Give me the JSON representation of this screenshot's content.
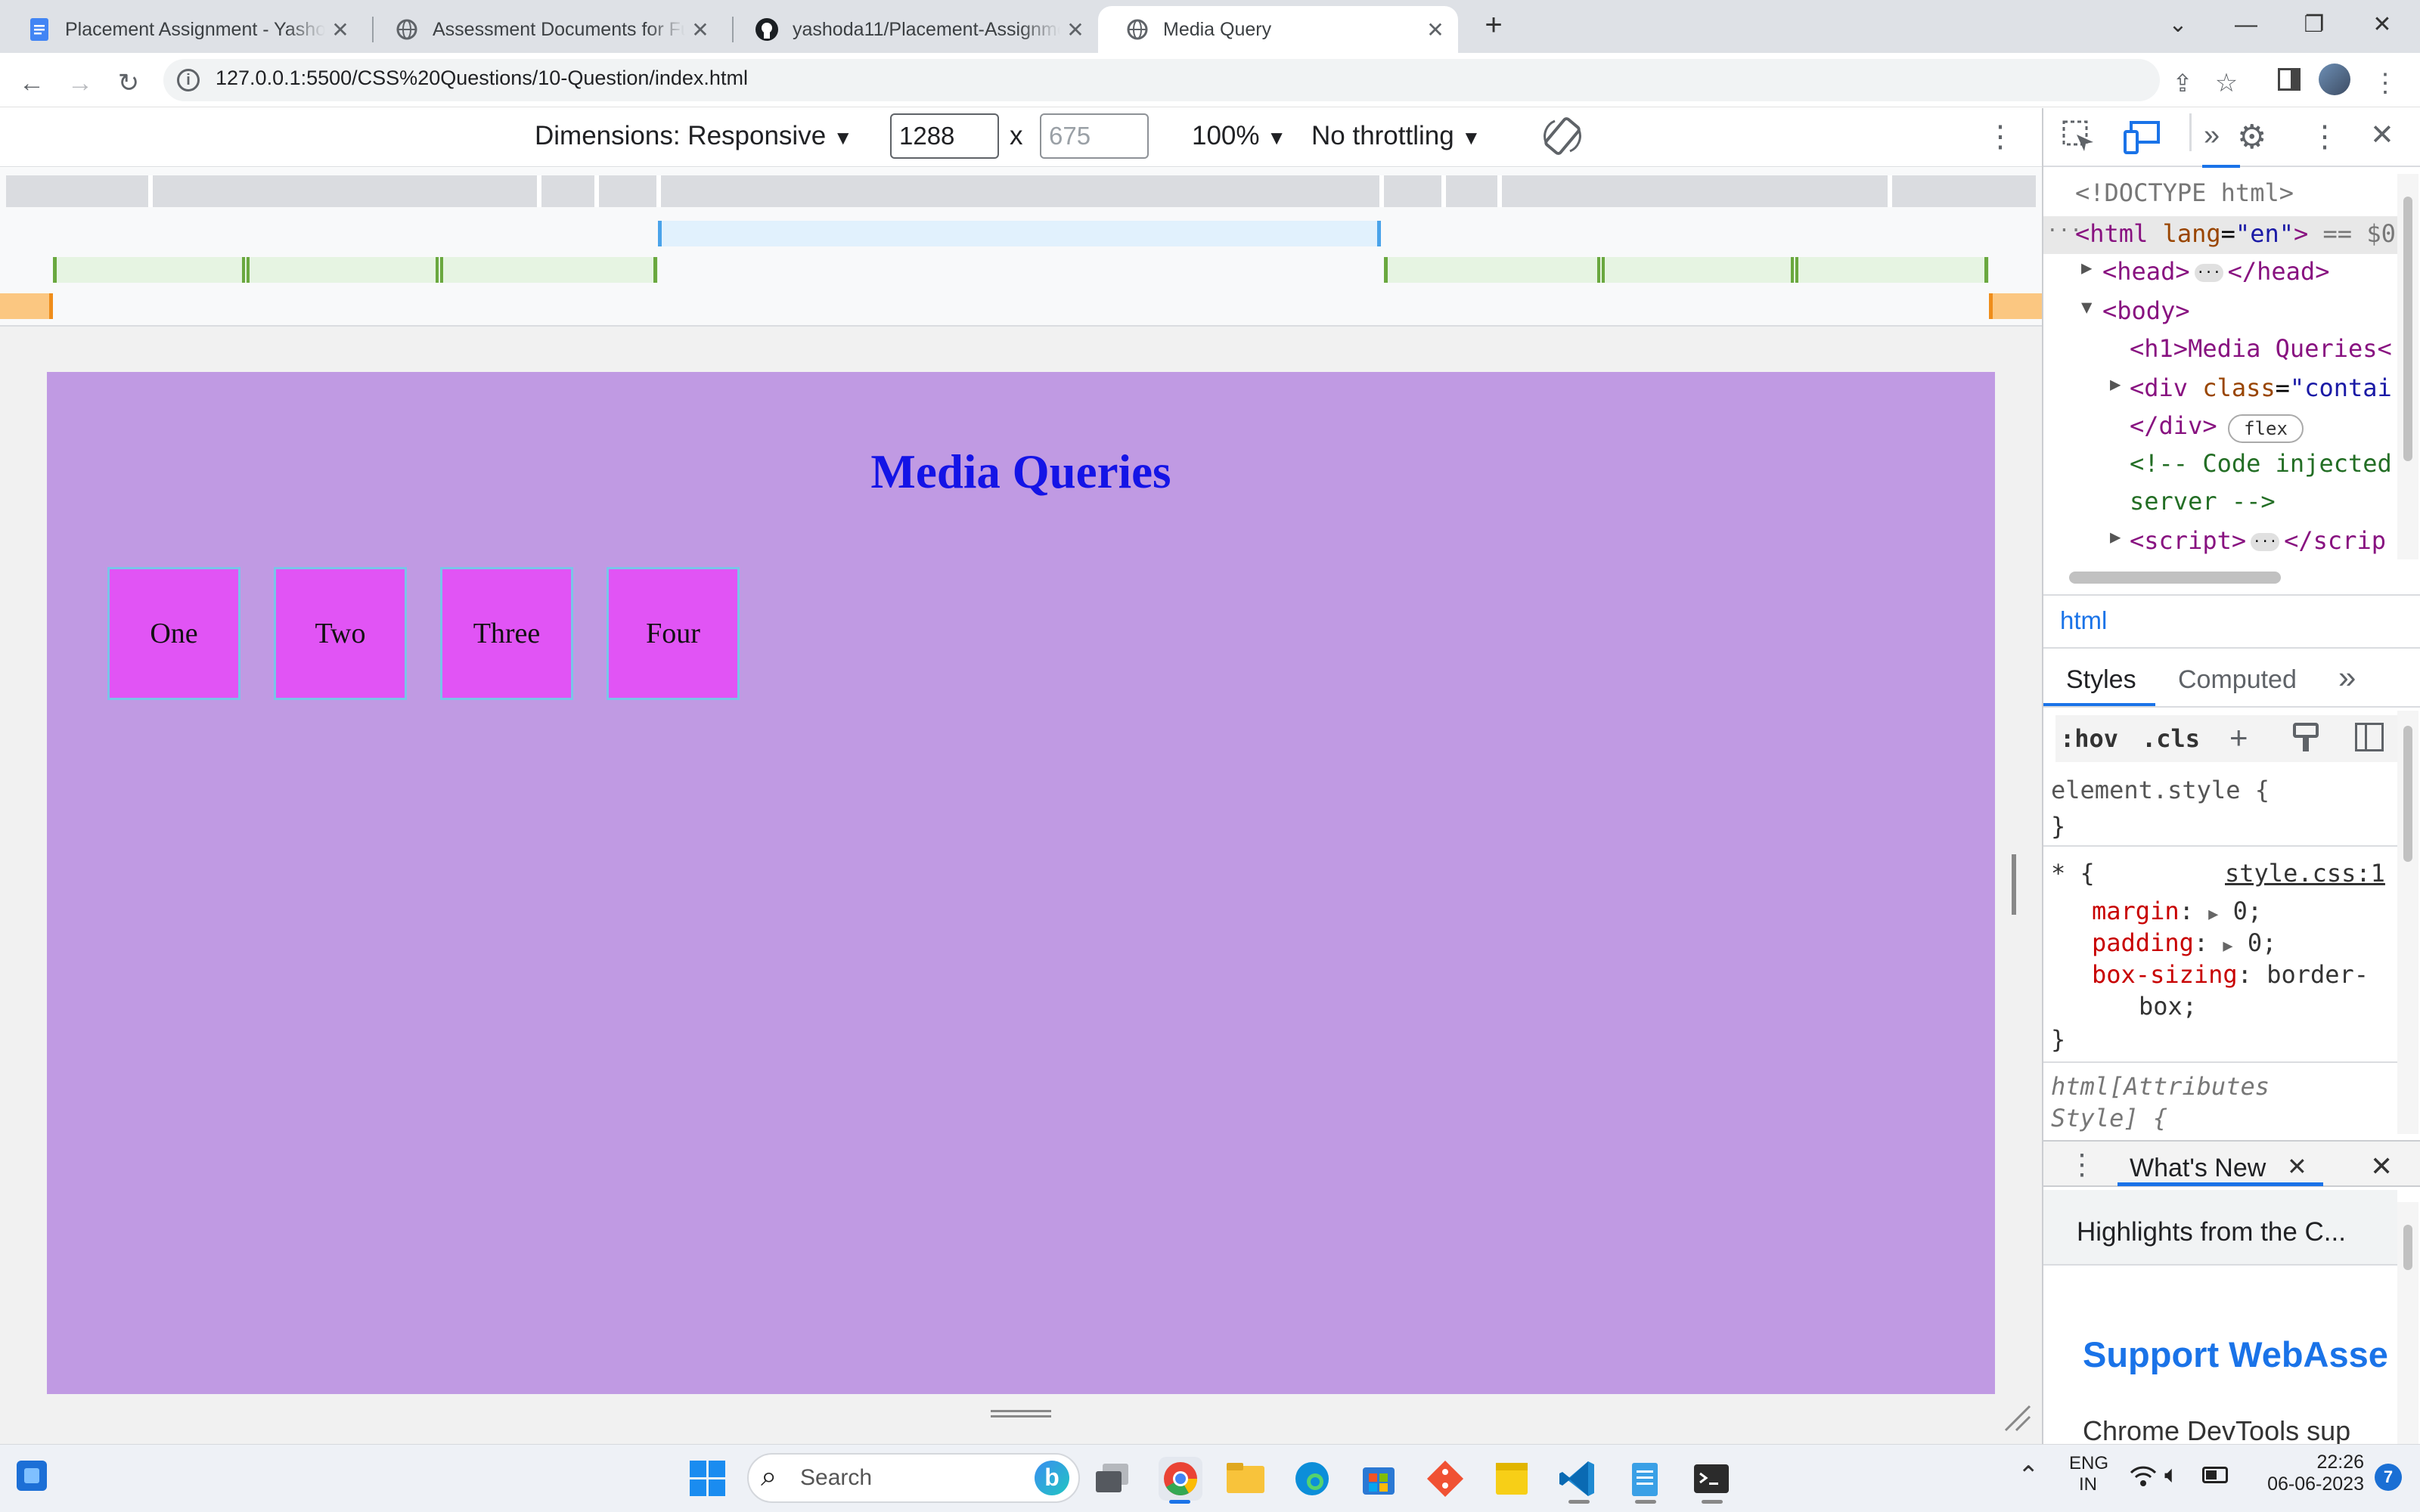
{
  "browser": {
    "tabs": [
      {
        "title": "Placement Assignment - Yashoda",
        "icon": "docs-icon"
      },
      {
        "title": "Assessment Documents for Full S",
        "icon": "globe-icon"
      },
      {
        "title": "yashoda11/Placement-Assignme",
        "icon": "github-icon"
      },
      {
        "title": "Media Query",
        "icon": "globe-icon"
      }
    ],
    "url": "127.0.0.1:5500/CSS%20Questions/10-Question/index.html"
  },
  "device_toolbar": {
    "dimensions_label": "Dimensions: Responsive",
    "width": "1288",
    "times": "x",
    "height": "675",
    "zoom": "100%",
    "throttling": "No throttling"
  },
  "page": {
    "heading": "Media Queries",
    "boxes": [
      "One",
      "Two",
      "Three",
      "Four"
    ],
    "colors": {
      "body": "#c09ae3",
      "heading": "#1414e6",
      "box": "#e154f5",
      "box_border": "#7ac4e8"
    }
  },
  "devtools": {
    "dom": {
      "doctype": "<!DOCTYPE html>",
      "html_open": "<html",
      "html_attr": "lang",
      "html_val": "\"en\"",
      "html_close": ">",
      "html_eq": "== $0",
      "head_open": "<head>",
      "head_close": "</head>",
      "body_open": "<body>",
      "h1": "<h1>Media Queries<",
      "div_open": "<div",
      "div_attr": "class",
      "div_val": "\"contai",
      "div_close": "</div>",
      "flex_badge": "flex",
      "comment1": "<!-- Code injected",
      "comment2": "server -->",
      "script_open": "<script>",
      "script_close": "</scrip"
    },
    "breadcrumb": "html",
    "tabs": [
      "Styles",
      "Computed"
    ],
    "styles_toolbar": {
      "hov": ":hov",
      "cls": ".cls"
    },
    "styles": {
      "element_style": "element.style {",
      "close_brace": "}",
      "star_selector": "* {",
      "source": "style.css:1",
      "margin_prop": "margin",
      "margin_val": "0;",
      "padding_prop": "padding",
      "padding_val": "0;",
      "boxsizing_prop": "box-sizing",
      "boxsizing_val": "border-",
      "boxsizing_val2": "box;",
      "html_attr_style1": "html[Attributes",
      "html_attr_style2": "Style] {"
    },
    "drawer": {
      "tab": "What's New",
      "highlights": "Highlights from the C...",
      "support": "Support WebAsse",
      "truncated": "Chrome DevTools sup"
    }
  },
  "taskbar": {
    "search": "Search",
    "lang1": "ENG",
    "lang2": "IN",
    "time": "22:26",
    "date": "06-06-2023",
    "notification_count": "7"
  }
}
